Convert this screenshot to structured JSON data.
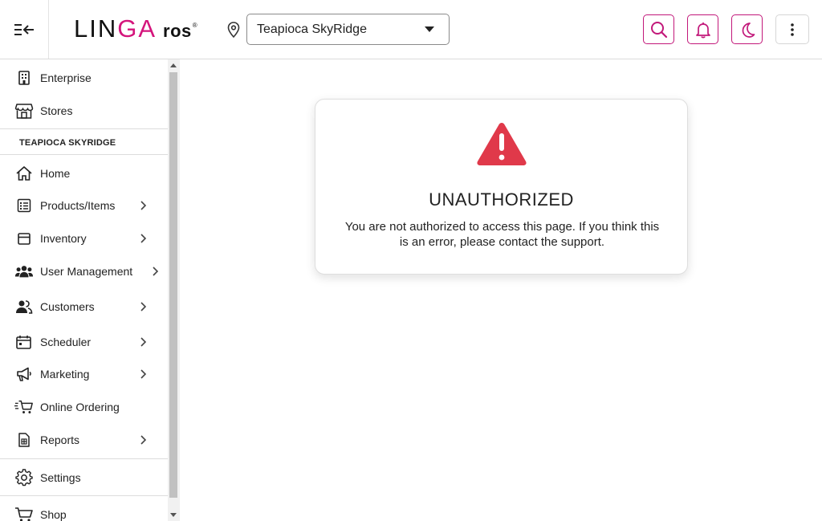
{
  "header": {
    "logo_main_a": "LIN",
    "logo_main_b": "GA",
    "logo_sub": "ros",
    "logo_reg": "®",
    "store_selected": "Teapioca SkyRidge"
  },
  "sidebar": {
    "top_items": [
      {
        "label": "Enterprise",
        "icon": "building-icon"
      },
      {
        "label": "Stores",
        "icon": "store-icon"
      }
    ],
    "section_title": "TEAPIOCA SKYRIDGE",
    "items": [
      {
        "label": "Home",
        "icon": "home-icon"
      },
      {
        "label": "Products/Items",
        "icon": "list-icon"
      },
      {
        "label": "Inventory",
        "icon": "box-icon"
      },
      {
        "label": "User Management",
        "icon": "users-icon"
      },
      {
        "label": "Customers",
        "icon": "customers-icon"
      },
      {
        "label": "Scheduler",
        "icon": "calendar-icon"
      },
      {
        "label": "Marketing",
        "icon": "megaphone-icon"
      },
      {
        "label": "Online Ordering",
        "icon": "cart-icon"
      },
      {
        "label": "Reports",
        "icon": "report-icon"
      }
    ],
    "bottom_items": [
      {
        "label": "Settings",
        "icon": "gear-icon"
      },
      {
        "label": "Shop",
        "icon": "shop-cart-icon"
      }
    ]
  },
  "main": {
    "title": "UNAUTHORIZED",
    "message": "You are not authorized to access this page. If you think this is an error, please contact the support."
  },
  "colors": {
    "brand": "#d4157c",
    "warning": "#e0394a"
  }
}
